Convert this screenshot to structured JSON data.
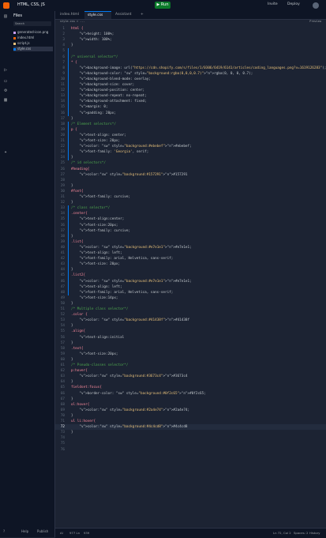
{
  "app": {
    "title": "HTML, CSS, JS",
    "run_label": "Run",
    "invite_label": "Invite",
    "deploy_label": "Deploy"
  },
  "files": {
    "header": "Files",
    "search_placeholder": "Search",
    "items": [
      {
        "name": "generated-icon.png",
        "color": "#c89ef5",
        "selected": false
      },
      {
        "name": "index.html",
        "color": "#f26207",
        "selected": false
      },
      {
        "name": "script.js",
        "color": "#e8c17a",
        "selected": false
      },
      {
        "name": "style.css",
        "color": "#0079f2",
        "selected": true
      }
    ],
    "help_label": "Help",
    "publish_label": "Publish"
  },
  "tabs": [
    {
      "label": "index.html",
      "active": false
    },
    {
      "label": "style.css",
      "active": true
    },
    {
      "label": "Assistant",
      "active": false
    }
  ],
  "editor": {
    "breadcrumb": "style.css > ...",
    "preview_label": "Preview"
  },
  "code": [
    "html {",
    "    height: 100%;",
    "    width: 100%;",
    "}",
    "",
    "/* universal selector*/",
    "* {",
    "    background-image: url(\"https://cdn.shopify.com/s/files/1/0306/6419/6141/articles/coding_languages.png?v=1619126283\");",
    "    background-color: rgba(0, 0, 0, 0.7);",
    "    background-blend-mode: overlay;",
    "    background-size: cover;",
    "    background-position: center;",
    "    background-repeat: no-repeat;",
    "    background-attachment: fixed;",
    "    margin: 0;",
    "    padding: 20px;",
    "}",
    "/* Element selectors*/",
    "p {",
    "    text-align: center;",
    "    font-size: 20px;",
    "    color: #ebebef;",
    "    font-family: 'Georgia', serif;",
    "}",
    "/* id selectors*/",
    "#heading{",
    "    color:#157291",
    "",
    "}",
    "#font{",
    "    font-family: cursive;",
    "}",
    "/* class selector*/",
    ".center{",
    "    text-align:center;",
    "    font-size:20px;",
    "    font-family: cursive;",
    "}",
    ".list{",
    "    color: #e7e1e1;",
    "    text-align: left;",
    "    font-family: arial, Helvetica, sans-serif;",
    "    font-size: 20px;",
    "}",
    ".list2{",
    "    color: #e7e1e1;",
    "    text-align: left;",
    "    font-family: arial, Helvetica, sans-serif;",
    "    font-size:14px;",
    "}",
    "/* Multiple class selector*/",
    ".color {",
    "    color: #41438f",
    "}",
    ".align{",
    "    text-align:initial",
    "}",
    ".text{",
    "    font-size:20px;",
    "}",
    "/* Pseudo-classes selector*/",
    "p:hover{",
    "    color:#3673c4",
    "}",
    "fieldset:focus{",
    "    border-color: #0f2c65;",
    "}",
    "ol:hover{",
    "    color:#2a4e74;",
    "}",
    "ul li:hover{",
    "    color:#4c4cd8",
    "}",
    "",
    "",
    ""
  ],
  "status": {
    "left1": "AI",
    "left2": "977 Ln",
    "left3": "939",
    "position": "Ln 72, Col 2",
    "spaces": "Spaces: 2",
    "history": "History"
  },
  "colors": {
    "accent": "#0079f2",
    "run": "#0b7a2a",
    "bg": "#1c2333",
    "panel": "#0e1525"
  }
}
